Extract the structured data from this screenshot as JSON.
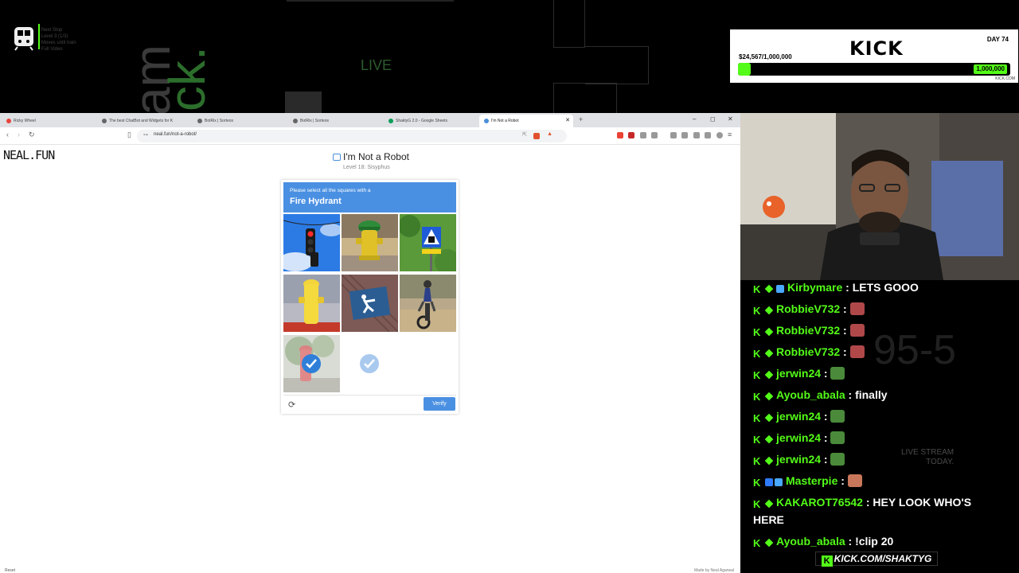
{
  "overlay": {
    "bg_text": "LIVE",
    "train_widget_lines": [
      "Next Stop",
      "Level 3 (1/3)",
      "Moves until train",
      "Full Video"
    ],
    "goal": {
      "brand": "KICK",
      "day": "DAY 74",
      "amount": "$24,567/1,000,000",
      "target": "1,000,000",
      "progress_fraction": 0.025,
      "site": "KICK.COM"
    },
    "chat_deco_number": "95-5",
    "chat_deco_live_lines": [
      "LIVE STREAM",
      "TODAY."
    ],
    "kick_banner": "KICK.COM/SHAKTYG"
  },
  "browser": {
    "tabs": [
      {
        "label": "Ricky Wheel",
        "active": false,
        "color": "#e8453c"
      },
      {
        "label": "The best ChatBot and Widgets for K",
        "active": false,
        "color": "#666666"
      },
      {
        "label": "BotRix | Sorteos",
        "active": false,
        "color": "#666666"
      },
      {
        "label": "BotRix | Sorteos",
        "active": false,
        "color": "#666666"
      },
      {
        "label": "ShaktyG 2.0 - Google Sheets",
        "active": false,
        "color": "#0f9d58"
      },
      {
        "label": "I'm Not a Robot",
        "active": true,
        "color": "#4a90d9"
      }
    ],
    "new_tab": "+",
    "url": "neal.fun/not-a-robot/"
  },
  "page": {
    "logo": "NEAL.FUN",
    "title": "I'm Not a Robot",
    "level": "Level 18: Sisyphus",
    "captcha": {
      "instruction": "Please select all the squares with a",
      "target": "Fire Hydrant",
      "verify_label": "Verify",
      "tiles": [
        {
          "name": "traffic-light-tile",
          "selected": false
        },
        {
          "name": "hydrant-with-hat-tile",
          "selected": false
        },
        {
          "name": "crosswalk-sign-tile",
          "selected": false
        },
        {
          "name": "yellow-hydrant-tile",
          "selected": false
        },
        {
          "name": "pedestrian-marking-tile",
          "selected": false
        },
        {
          "name": "dirt-bike-tile",
          "selected": false
        },
        {
          "name": "red-hydrant-tile",
          "selected": true
        },
        {
          "name": "empty-tile",
          "selected": true
        },
        {
          "name": "blank-tile",
          "selected": false
        }
      ]
    }
  },
  "status": {
    "bottom_left": "Reset",
    "bottom_right": "Made by Neal Agarwal"
  },
  "chat": [
    {
      "badges": "kdg",
      "user": "Kirbymare",
      "text": "LETS GOOO",
      "emote": ""
    },
    {
      "badges": "kd",
      "user": "RobbieV732",
      "text": "",
      "emote": "#b0484a"
    },
    {
      "badges": "kd",
      "user": "RobbieV732",
      "text": "",
      "emote": "#b0484a"
    },
    {
      "badges": "kd",
      "user": "RobbieV732",
      "text": "",
      "emote": "#b0484a"
    },
    {
      "badges": "kd",
      "user": "jerwin24",
      "text": "",
      "emote": "#4a8a3a"
    },
    {
      "badges": "kd",
      "user": "Ayoub_abala",
      "text": "finally",
      "emote": ""
    },
    {
      "badges": "kd",
      "user": "jerwin24",
      "text": "",
      "emote": "#4a8a3a"
    },
    {
      "badges": "kd",
      "user": "jerwin24",
      "text": "",
      "emote": "#4a8a3a"
    },
    {
      "badges": "kd",
      "user": "jerwin24",
      "text": "",
      "emote": "#4a8a3a"
    },
    {
      "badges": "kbg",
      "user": "Masterpie",
      "text": "",
      "emote": "#c8775a"
    },
    {
      "badges": "kd",
      "user": "KAKAROT76542",
      "text": "HEY LOOK WHO'S",
      "emote": ""
    },
    {
      "badges": "",
      "user": "",
      "text": "HERE",
      "emote": ""
    },
    {
      "badges": "kd",
      "user": "Ayoub_abala",
      "text": "!clip 20",
      "emote": ""
    }
  ]
}
